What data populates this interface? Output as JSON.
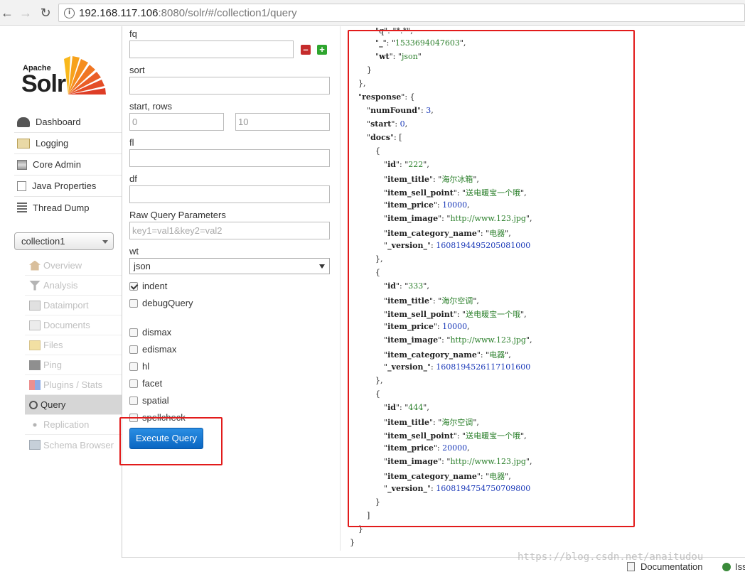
{
  "browser": {
    "url_host": "192.168.117.106",
    "url_path": ":8080/solr/#/collection1/query"
  },
  "logo": {
    "top": "Apache",
    "main": "Solr"
  },
  "nav": [
    {
      "label": "Dashboard",
      "icon": "dashboard-icon"
    },
    {
      "label": "Logging",
      "icon": "logging-icon"
    },
    {
      "label": "Core Admin",
      "icon": "core-admin-icon"
    },
    {
      "label": "Java Properties",
      "icon": "java-properties-icon"
    },
    {
      "label": "Thread Dump",
      "icon": "thread-dump-icon"
    }
  ],
  "core_selector": {
    "value": "collection1"
  },
  "core_nav": [
    {
      "label": "Overview",
      "icon": "home-icon"
    },
    {
      "label": "Analysis",
      "icon": "funnel-icon"
    },
    {
      "label": "Dataimport",
      "icon": "dataimport-icon"
    },
    {
      "label": "Documents",
      "icon": "documents-icon"
    },
    {
      "label": "Files",
      "icon": "files-icon"
    },
    {
      "label": "Ping",
      "icon": "ping-icon"
    },
    {
      "label": "Plugins / Stats",
      "icon": "plugins-icon"
    },
    {
      "label": "Query",
      "icon": "query-icon"
    },
    {
      "label": "Replication",
      "icon": "replication-icon"
    },
    {
      "label": "Schema Browser",
      "icon": "schema-icon"
    }
  ],
  "form": {
    "fq_label": "fq",
    "fq_value": "",
    "sort_label": "sort",
    "sort_value": "",
    "start_rows_label": "start, rows",
    "start_value": "0",
    "rows_value": "10",
    "fl_label": "fl",
    "fl_value": "",
    "df_label": "df",
    "df_value": "",
    "raw_label": "Raw Query Parameters",
    "raw_placeholder": "key1=val1&key2=val2",
    "wt_label": "wt",
    "wt_value": "json",
    "indent_label": "indent",
    "debug_label": "debugQuery",
    "dismax_label": "dismax",
    "edismax_label": "edismax",
    "hl_label": "hl",
    "facet_label": "facet",
    "spatial_label": "spatial",
    "spellcheck_label": "spellcheck",
    "execute_label": "Execute Query"
  },
  "response": {
    "top_line": "\"q\": \"*:*\",",
    "underscore": "1533694047603",
    "wt": "json",
    "numFound": "3",
    "start": "0",
    "docs": [
      {
        "id": "222",
        "item_title": "海尔冰箱",
        "item_sell_point": "送电暖宝一个哦",
        "item_price": "10000",
        "item_image": "http://www.123.jpg",
        "item_category_name": "电器",
        "_version_": "1608194495205081000"
      },
      {
        "id": "333",
        "item_title": "海尔空调",
        "item_sell_point": "送电暖宝一个哦",
        "item_price": "10000",
        "item_image": "http://www.123.jpg",
        "item_category_name": "电器",
        "_version_": "1608194526117101600"
      },
      {
        "id": "444",
        "item_title": "海尔空调",
        "item_sell_point": "送电暖宝一个哦",
        "item_price": "20000",
        "item_image": "http://www.123.jpg",
        "item_category_name": "电器",
        "_version_": "1608194754750709800"
      }
    ]
  },
  "footer": {
    "documentation": "Documentation",
    "issues": "Iss",
    "watermark": "https://blog.csdn.net/anaitudou"
  }
}
